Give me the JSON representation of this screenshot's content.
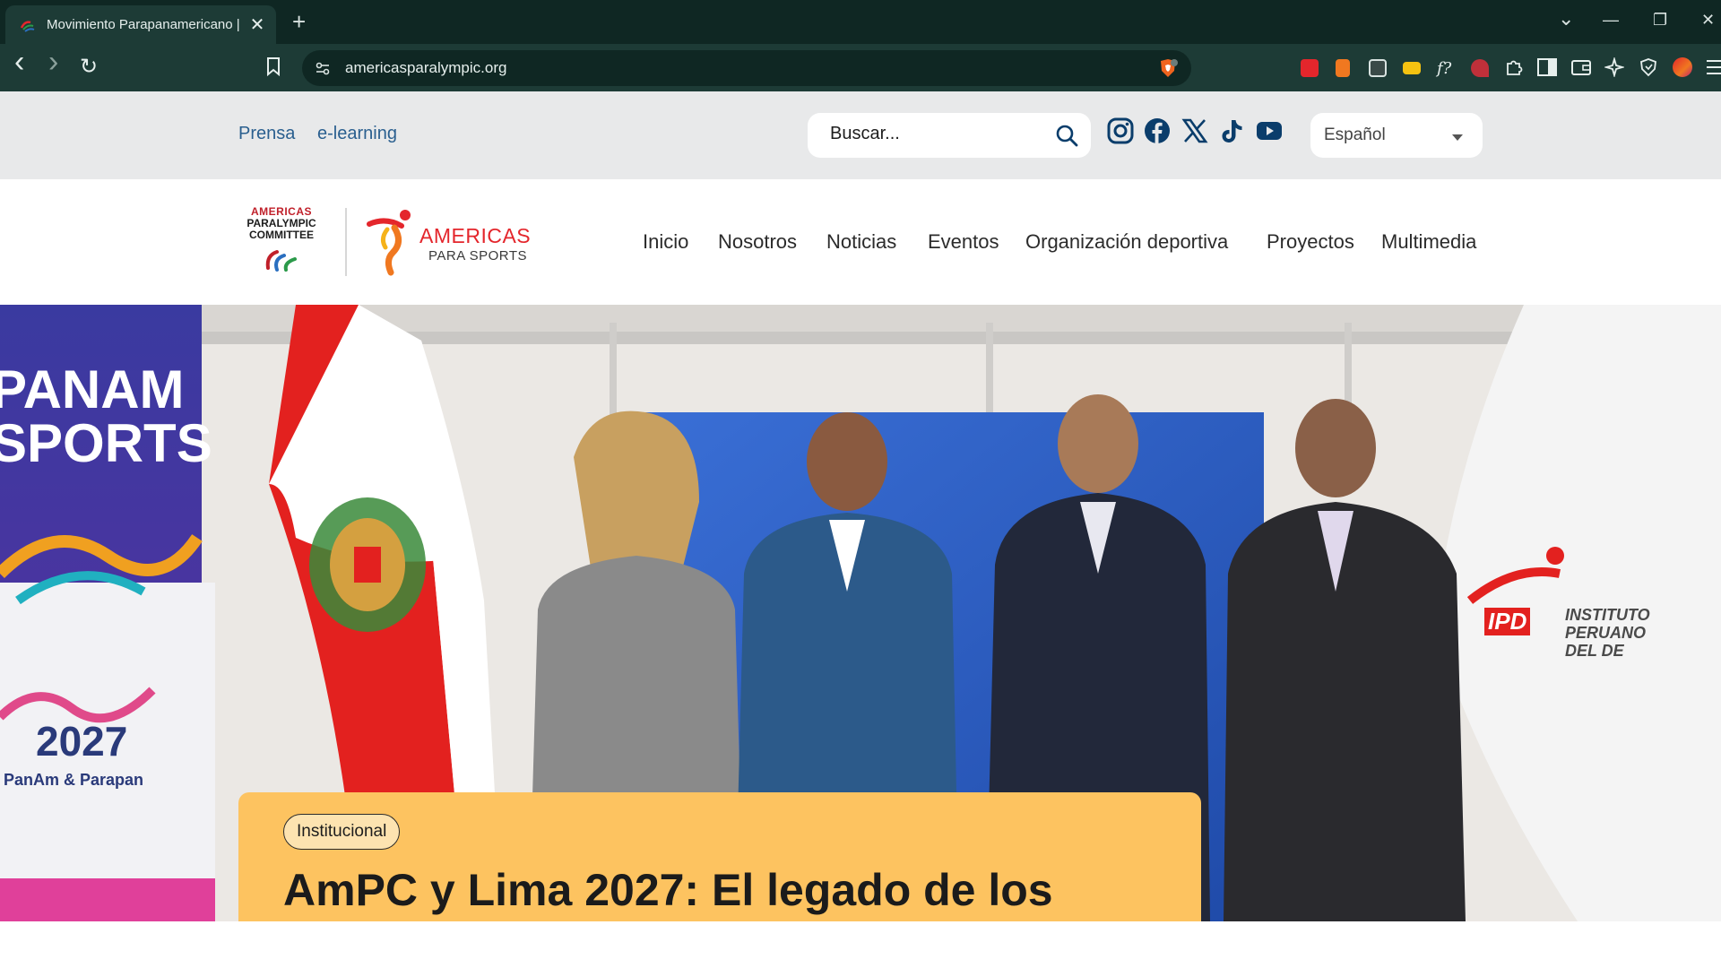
{
  "browser": {
    "tab_title": "Movimiento Parapanamericano |",
    "tab_close": "✕",
    "new_tab": "+",
    "url": "americasparalympic.org",
    "back": "‹",
    "forward": "›",
    "reload": "↻",
    "minimize": "—",
    "restore": "❐",
    "close": "✕",
    "tab_list": "⌄"
  },
  "topbar": {
    "links": [
      "Prensa",
      "e-learning"
    ],
    "search_placeholder": "Buscar...",
    "social": [
      "instagram-icon",
      "facebook-icon",
      "x-icon",
      "tiktok-icon",
      "youtube-icon"
    ],
    "language": "Español"
  },
  "logo": {
    "apc_line1": "AMERICAS",
    "apc_line2": "PARALYMPIC",
    "apc_line3": "COMMITTEE",
    "ps_line1": "AMERICAS",
    "ps_line2": "PARA SPORTS"
  },
  "nav": {
    "items": [
      "Inicio",
      "Nosotros",
      "Noticias",
      "Eventos",
      "Organización deportiva",
      "Proyectos",
      "Multimedia"
    ]
  },
  "hero": {
    "banner_text1": "PANAM",
    "banner_text2": "SPORTS",
    "banner_year": "2027",
    "banner_sub": "PanAm & Parapan",
    "ipd_text": "IPD",
    "ipd_name1": "INSTITUTO",
    "ipd_name2": "PERUANO",
    "ipd_name3": "DEL DE",
    "category": "Institucional",
    "headline": "AmPC y Lima 2027: El legado de los"
  },
  "colors": {
    "chrome_dark": "#0f2723",
    "chrome_mid": "#1d3b36",
    "topbar_bg": "#e8e9ea",
    "link_blue": "#2a5f8f",
    "social_blue": "#0a3d6b",
    "card_yellow": "#fdc360",
    "brand_red": "#e4262c"
  }
}
